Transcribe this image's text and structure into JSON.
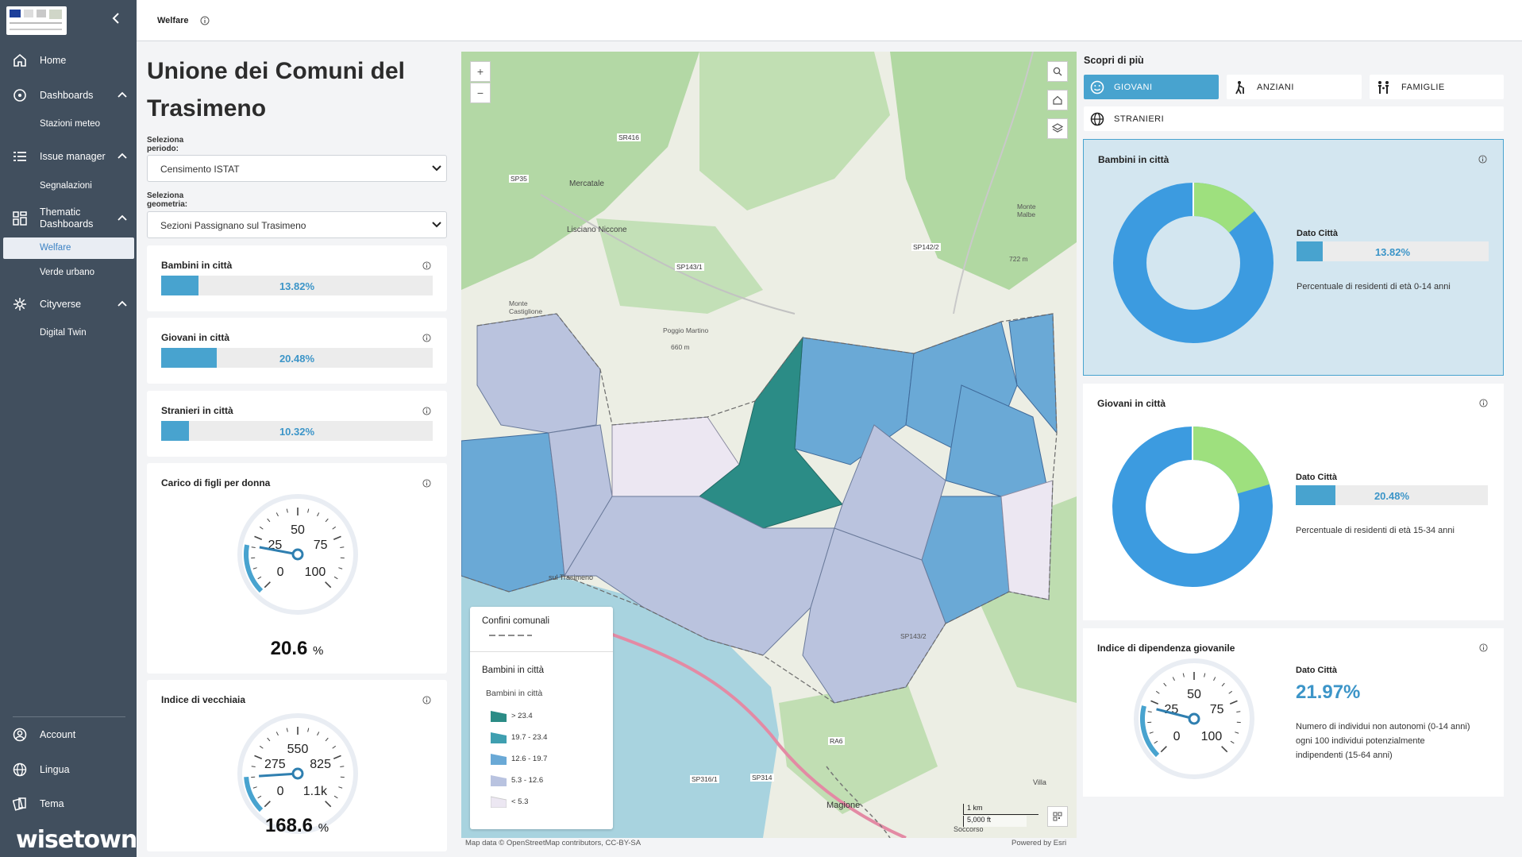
{
  "sidebar": {
    "items": [
      {
        "label": "Home",
        "icon": "home-icon"
      },
      {
        "label": "Dashboards",
        "icon": "dashboards-icon"
      },
      {
        "label": "Stazioni meteo"
      },
      {
        "label": "Issue manager",
        "icon": "list-icon"
      },
      {
        "label": "Segnalazioni"
      },
      {
        "label": "Thematic Dashboards",
        "icon": "grid-icon"
      },
      {
        "label": "Welfare"
      },
      {
        "label": "Verde urbano"
      },
      {
        "label": "Cityverse",
        "icon": "cityverse-icon"
      },
      {
        "label": "Digital Twin"
      }
    ],
    "bottom": [
      {
        "label": "Account",
        "icon": "account-icon"
      },
      {
        "label": "Lingua",
        "icon": "globe-icon"
      },
      {
        "label": "Tema",
        "icon": "theme-icon"
      }
    ],
    "brand": "wisetown"
  },
  "topbar": {
    "title": "Welfare"
  },
  "left": {
    "title": "Unione dei Comuni del Trasimeno",
    "period_label": "Seleziona periodo:",
    "period_value": "Censimento ISTAT",
    "geometry_label": "Seleziona geometria:",
    "geometry_value": "Sezioni Passignano sul Trasimeno",
    "bars": [
      {
        "title": "Bambini in città",
        "value": "13.82%",
        "fraction": 0.1382
      },
      {
        "title": "Giovani in città",
        "value": "20.48%",
        "fraction": 0.2048
      },
      {
        "title": "Stranieri in città",
        "value": "10.32%",
        "fraction": 0.1032
      }
    ],
    "gauges": [
      {
        "title": "Carico di figli per donna",
        "ticks": [
          "0",
          "25",
          "50",
          "75",
          "100"
        ],
        "value": "20.6",
        "unit": "%",
        "fraction": 0.206
      },
      {
        "title": "Indice di vecchiaia",
        "ticks": [
          "0",
          "275",
          "550",
          "825",
          "1.1k"
        ],
        "value": "168.6",
        "unit": "%",
        "fraction": 0.153
      }
    ]
  },
  "map": {
    "attribution_left": "Map data © OpenStreetMap contributors, CC-BY-SA",
    "attribution_right": "Powered by Esri",
    "zoom_in": "+",
    "zoom_out": "−",
    "scale_km": "1 km",
    "scale_ft": "5,000 ft",
    "legend": {
      "group1": "Confini comunali",
      "group2": "Bambini in città",
      "sub": "Bambini in città",
      "classes": [
        {
          "label": "> 23.4",
          "color": "#2b8c86"
        },
        {
          "label": "19.7 - 23.4",
          "color": "#3f9fb0"
        },
        {
          "label": "12.6 - 19.7",
          "color": "#6aa9d6"
        },
        {
          "label": "5.3 - 12.6",
          "color": "#b9c3e0"
        },
        {
          "label": "< 5.3",
          "color": "#ece7f2"
        }
      ]
    },
    "places": [
      {
        "label": "Mercatale"
      },
      {
        "label": "Lisciano Niccone"
      },
      {
        "label": "Poggio Martino"
      },
      {
        "label": "660 m"
      },
      {
        "label": "SP143/1"
      },
      {
        "label": "SP142/2"
      },
      {
        "label": "SR416"
      },
      {
        "label": "SP35"
      },
      {
        "label": "Magione"
      },
      {
        "label": "Villa"
      },
      {
        "label": "SP314"
      },
      {
        "label": "SP316/1"
      },
      {
        "label": "RA6"
      },
      {
        "label": "sul Trasimeno"
      },
      {
        "label": "Monte Castiglione"
      },
      {
        "label": "Monte Malbe"
      },
      {
        "label": "722 m"
      },
      {
        "label": "SP143/2"
      },
      {
        "label": "Soccorso"
      }
    ]
  },
  "right": {
    "title": "Scopri di più",
    "tabs": [
      {
        "label": "GIOVANI",
        "icon": "smile-icon",
        "active": true
      },
      {
        "label": "ANZIANI",
        "icon": "elderly-icon",
        "active": false
      },
      {
        "label": "FAMIGLIE",
        "icon": "family-icon",
        "active": false
      },
      {
        "label": "STRANIERI",
        "icon": "globe-icon",
        "active": false
      }
    ],
    "data_label": "Dato Città",
    "cards": [
      {
        "title": "Bambini in città",
        "value": "13.82%",
        "fraction": 0.1382,
        "desc": "Percentuale di residenti di età 0-14 anni"
      },
      {
        "title": "Giovani in città",
        "value": "20.48%",
        "fraction": 0.2048,
        "desc": "Percentuale di residenti di età 15-34 anni"
      }
    ],
    "gauge_card": {
      "title": "Indice di dipendenza giovanile",
      "ticks": [
        "0",
        "25",
        "50",
        "75",
        "100"
      ],
      "value": "21.97%",
      "fraction": 0.2197,
      "desc1": "Numero di individui non autonomi (0-14 anni)",
      "desc2": "ogni 100 individui potenzialmente",
      "desc3": "indipendenti (15-64 anni)"
    }
  },
  "colors": {
    "accent": "#48a3cf",
    "sidebar": "#414f5e",
    "donut_main": "#3c9be0",
    "donut_part": "#9ee07e"
  }
}
